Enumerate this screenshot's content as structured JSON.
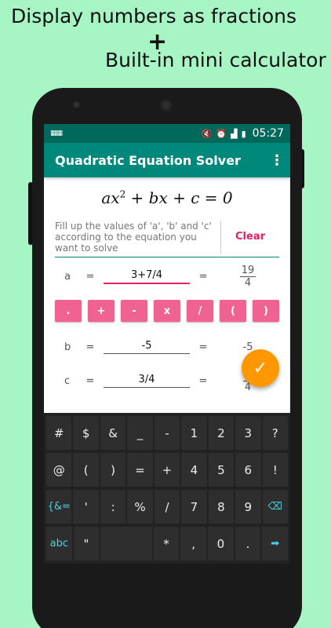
{
  "promo": {
    "line1": "Display numbers as fractions",
    "plus": "+",
    "line2": "Built-in mini calculator"
  },
  "status": {
    "keyboard_icon": "keyboard-icon",
    "time": "05:27"
  },
  "appbar": {
    "title": "Quadratic Equation Solver",
    "menu": "⋮"
  },
  "equation": {
    "a": "ax",
    "exp": "2",
    "rest": " + bx + c = 0"
  },
  "hint": {
    "text": "Fill up the values of 'a', 'b' and 'c' according to the equation you want to solve",
    "clear_label": "Clear"
  },
  "coefficients": {
    "a": {
      "label": "a",
      "eq": "=",
      "value": "3+7/4",
      "result_eq": "=",
      "result_num": "19",
      "result_den": "4"
    },
    "b": {
      "label": "b",
      "eq": "=",
      "value": "-5",
      "result_eq": "=",
      "result": "-5"
    },
    "c": {
      "label": "c",
      "eq": "=",
      "value": "3/4",
      "result_eq": "=",
      "result_num": "3",
      "result_den": "4"
    }
  },
  "operators": [
    ".",
    "+",
    "-",
    "x",
    "/",
    "(",
    ")"
  ],
  "fab": {
    "icon": "check-icon",
    "glyph": "✓"
  },
  "keyboard": {
    "row1": [
      "#",
      "$",
      "&",
      "_",
      "-",
      "1",
      "2",
      "3",
      "?"
    ],
    "row2": [
      "@",
      "(",
      ")",
      "=",
      "+",
      "4",
      "5",
      "6",
      "!"
    ],
    "row3": [
      "{&=",
      "'",
      ":",
      "%",
      "/",
      "7",
      "8",
      "9",
      "⌫"
    ],
    "row4": [
      "abc",
      "\"",
      "",
      "*",
      ",",
      "0",
      ".",
      "➡"
    ]
  },
  "colors": {
    "background": "#a7f5c4",
    "appbar": "#00897b",
    "statusbar": "#00695c",
    "accent": "#e91e63",
    "operator_button": "#f06292",
    "fab": "#ff9800",
    "keyboard": "#222222"
  }
}
